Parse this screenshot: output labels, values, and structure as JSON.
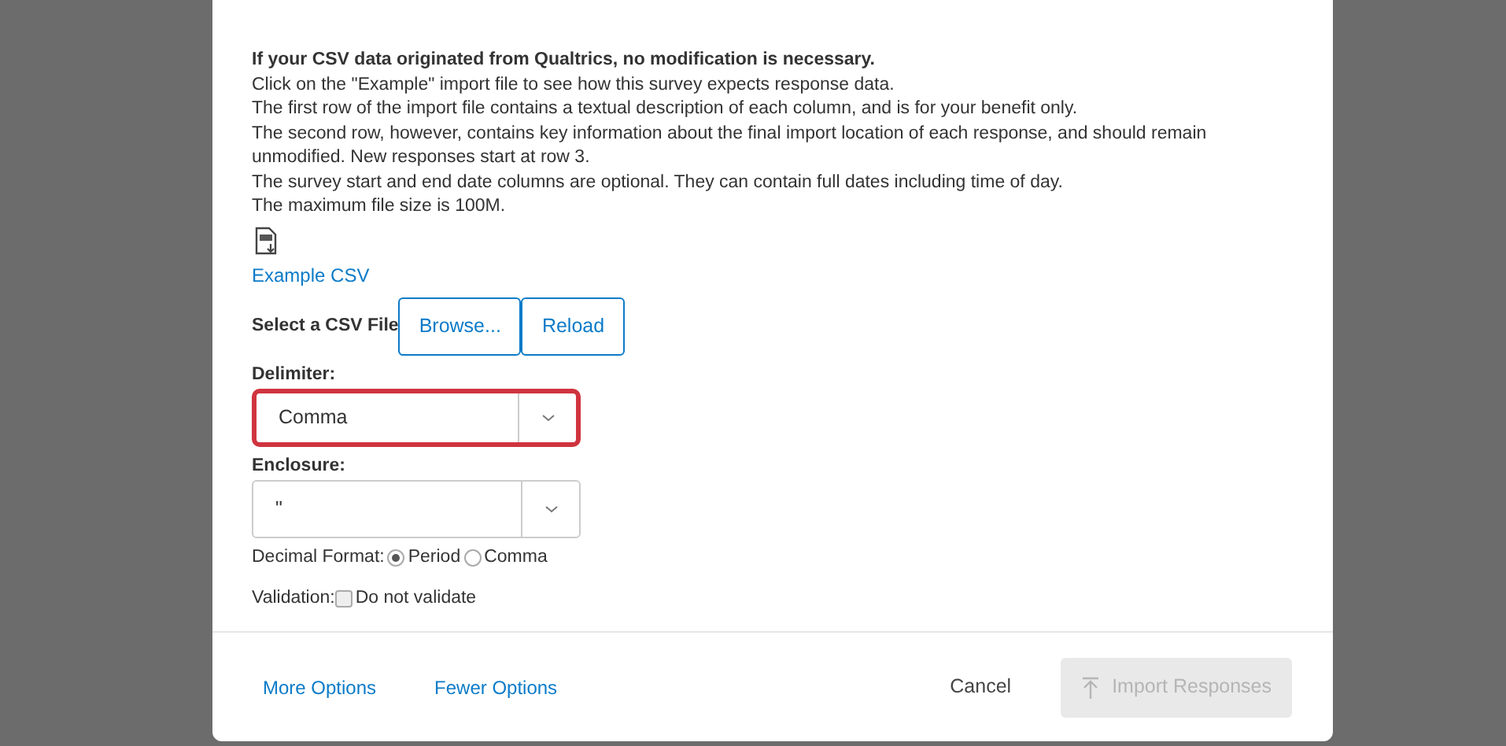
{
  "instructions": {
    "heading": "If your CSV data originated from Qualtrics, no modification is necessary.",
    "lines": [
      "Click on the \"Example\" import file to see how this survey expects response data.",
      "The first row of the import file contains a textual description of each column, and is for your benefit only.",
      "The second row, however, contains key information about the final import location of each response, and should remain unmodified. New responses start at row 3.",
      "The survey start and end date columns are optional. They can contain full dates including time of day.",
      "The maximum file size is 100M."
    ]
  },
  "example_link": "Example CSV",
  "file_select": {
    "label": "Select a CSV File",
    "buttons": [
      "Browse...",
      "Reload"
    ]
  },
  "selects": [
    {
      "label": "Delimiter:",
      "value": "Comma",
      "highlighted": true
    },
    {
      "label": "Enclosure:",
      "value": "\"",
      "highlighted": false
    }
  ],
  "decimal_format": {
    "label": "Decimal Format:",
    "options": [
      {
        "label": "Period",
        "selected": true
      },
      {
        "label": "Comma",
        "selected": false
      }
    ]
  },
  "validation": {
    "label": "Validation:",
    "option": "Do not validate",
    "checked": false
  },
  "footer": {
    "links": [
      "More Options",
      "Fewer Options"
    ],
    "cancel": "Cancel",
    "import": {
      "label": "Import Responses",
      "disabled": true
    }
  }
}
